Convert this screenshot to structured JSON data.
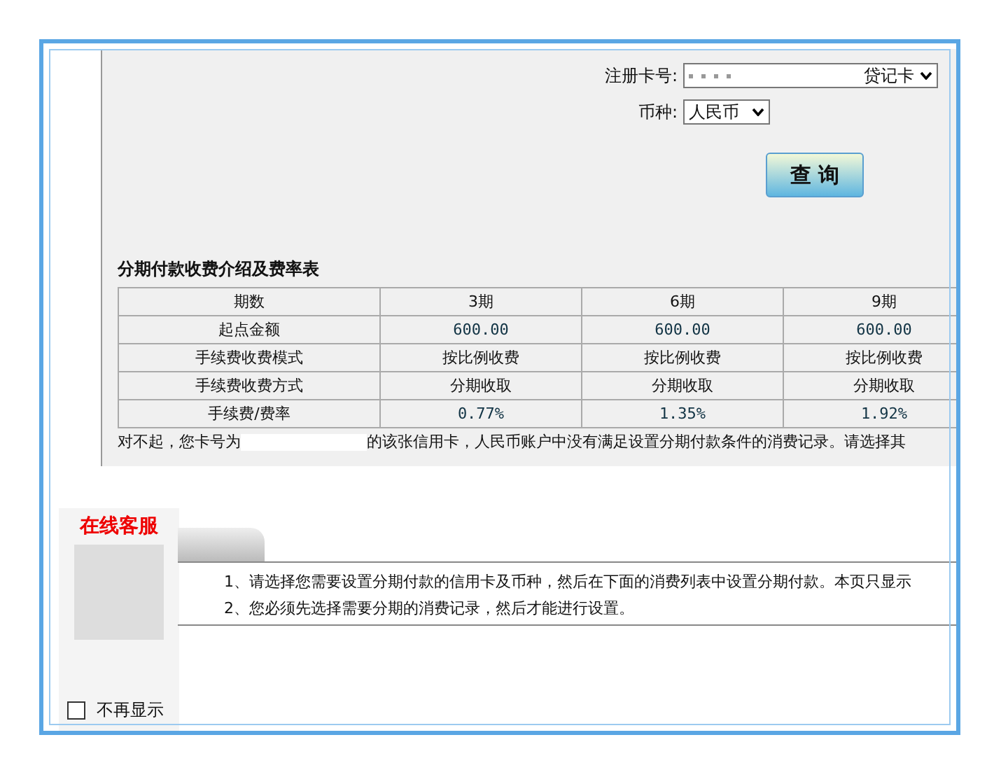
{
  "form": {
    "card_label": "注册卡号:",
    "card_type": "贷记卡",
    "currency_label": "币种:",
    "currency": "人民币",
    "query_button": "查 询"
  },
  "fee_table": {
    "title": "分期付款收费介绍及费率表",
    "columns": [
      "期数",
      "3期",
      "6期",
      "9期"
    ],
    "rows": [
      [
        "起点金额",
        "600.00",
        "600.00",
        "600.00"
      ],
      [
        "手续费收费模式",
        "按比例收费",
        "按比例收费",
        "按比例收费"
      ],
      [
        "手续费收费方式",
        "分期收取",
        "分期收取",
        "分期收取"
      ],
      [
        "手续费/费率",
        "0.77%",
        "1.35%",
        "1.92%"
      ]
    ]
  },
  "message": {
    "before": "对不起，您卡号为",
    "after": "的该张信用卡，人民币账户中没有满足设置分期付款条件的消费记录。请选择其"
  },
  "support": {
    "title": "在线客服",
    "dont_show": {
      "label": "不再显示",
      "checked": false
    }
  },
  "instructions": [
    {
      "number": "1、",
      "text": "请选择您需要设置分期付款的信用卡及币种，然后在下面的消费列表中设置分期付款。本页只显示"
    },
    {
      "number": "2、",
      "text": "您必须先选择需要分期的消费记录，然后才能进行设置。"
    }
  ]
}
